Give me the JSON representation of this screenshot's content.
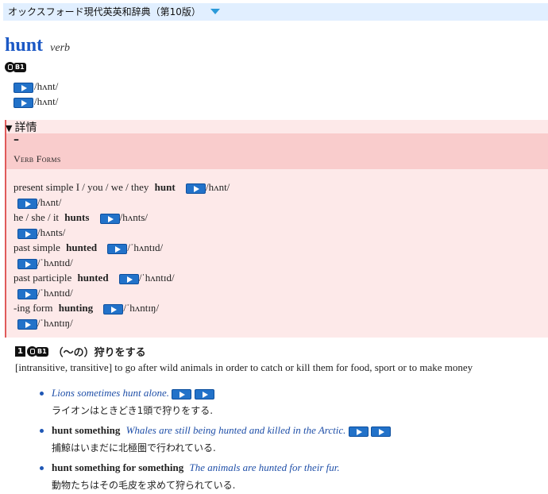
{
  "dictionary": {
    "name": "オックスフォード現代英英和辞典（第10版）"
  },
  "entry": {
    "headword": "hunt",
    "pos": "verb",
    "level": "B1",
    "pronunciations": [
      "/hʌnt/",
      "/hʌnt/"
    ]
  },
  "details": {
    "summary": "詳情",
    "dash": "–",
    "verb_forms_title": "Verb Forms",
    "forms": [
      {
        "label": "present simple I / you / we / they",
        "form": "hunt",
        "ipa1": "/hʌnt/",
        "ipa2": "/hʌnt/"
      },
      {
        "label": "he / she / it",
        "form": "hunts",
        "ipa1": "/hʌnts/",
        "ipa2": "/hʌnts/"
      },
      {
        "label": "past simple",
        "form": "hunted",
        "ipa1": "/ˈhʌntɪd/",
        "ipa2": "/ˈhʌntɪd/"
      },
      {
        "label": "past participle",
        "form": "hunted",
        "ipa1": "/ˈhʌntɪd/",
        "ipa2": "/ˈhʌntɪd/"
      },
      {
        "label": "-ing form",
        "form": "hunting",
        "ipa1": "/ˈhʌntɪŋ/",
        "ipa2": "/ˈhʌntɪŋ/"
      }
    ]
  },
  "sense": {
    "number": "1",
    "level": "B1",
    "jp_heading": "（～の）狩りをする",
    "definition": "[intransitive, transitive] to go after wild animals in order to catch or kill them for food, sport or to make money",
    "examples": [
      {
        "pattern": "",
        "english": "Lions sometimes hunt alone.",
        "japanese": "ライオンはときどき1頭で狩りをする."
      },
      {
        "pattern": "hunt something",
        "english": "Whales are still being hunted and killed in the Arctic.",
        "japanese": "捕鯨はいまだに北極圏で行われている."
      },
      {
        "pattern": "hunt something for something",
        "english": "The animals are hunted for their fur.",
        "japanese": "動物たちはその毛皮を求めて狩られている."
      }
    ]
  },
  "colors": {
    "headword": "#1b58c5",
    "example": "#1f4fa8",
    "details_bg": "#fde9e9",
    "details_header_bg": "#f9cccc",
    "topbar_bg": "#e1efff"
  }
}
